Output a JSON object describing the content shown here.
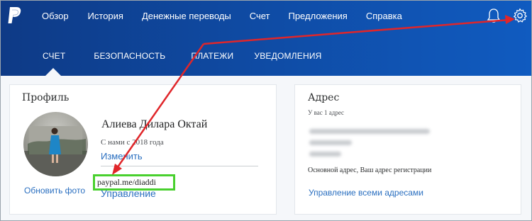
{
  "header": {
    "nav": [
      "Обзор",
      "История",
      "Денежные переводы",
      "Счет",
      "Предложения",
      "Справка"
    ],
    "tabs": [
      "СЧЕТ",
      "БЕЗОПАСНОСТЬ",
      "ПЛАТЕЖИ",
      "УВЕДОМЛЕНИЯ"
    ],
    "active_tab": "СЧЕТ"
  },
  "profile": {
    "title": "Профиль",
    "name": "Алиева Дилара Октай",
    "since": "С нами с 2018 года",
    "edit_label": "Изменить",
    "update_photo_label": "Обновить фото",
    "paypal_me": "paypal.me/diaddi",
    "manage_label": "Управление"
  },
  "address": {
    "title": "Адрес",
    "count_text": "У вас 1 адрес",
    "note": "Основной адрес, Ваш адрес регистрации",
    "manage_all_label": "Управление всеми адресами"
  },
  "colors": {
    "header_start": "#0e3a86",
    "header_end": "#105bc0",
    "link": "#2a6fc0",
    "highlight_box": "#49d02e",
    "annotation_arrow": "#e0262a"
  }
}
